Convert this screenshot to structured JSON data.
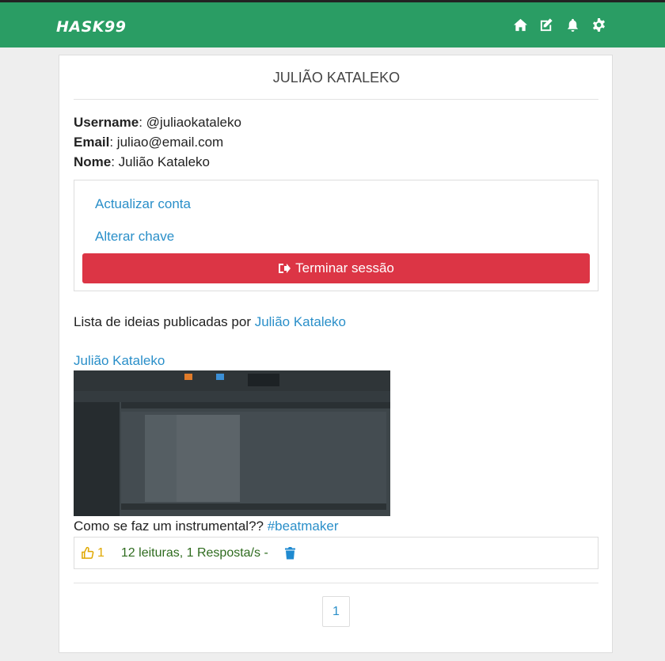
{
  "header": {
    "brand": "HASK99",
    "icons": [
      "home-icon",
      "edit-icon",
      "bell-icon",
      "gear-icon"
    ]
  },
  "profile": {
    "name_title": "JULIÃO KATALEKO",
    "username_label": "Username",
    "username_value": ": @juliaokataleko",
    "email_label": "Email",
    "email_value": ": juliao@email.com",
    "nome_label": "Nome",
    "nome_value": ": Julião Kataleko"
  },
  "account": {
    "update_link": "Actualizar conta",
    "change_password_link": "Alterar chave",
    "logout_label": "Terminar sessão"
  },
  "ideas": {
    "list_heading": "Lista de ideias publicadas por ",
    "list_heading_author": "Julião Kataleko",
    "post": {
      "author": "Julião Kataleko",
      "question": "Como se faz um instrumental?? ",
      "hashtag": "#beatmaker",
      "likes": "1",
      "stats_text": "12 leituras, 1 Resposta/s -"
    }
  },
  "pagination": {
    "current_page": "1"
  },
  "colors": {
    "header_bg": "#2a9d64",
    "link": "#2a8fc9",
    "danger": "#dc3545",
    "like": "#e0a800",
    "reads": "#2e6b1e"
  }
}
